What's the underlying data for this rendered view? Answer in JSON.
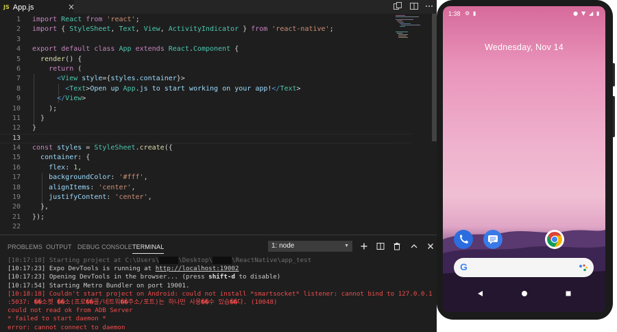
{
  "editor_tab": {
    "badge": "JS",
    "filename": "App.js",
    "close": "×"
  },
  "code": {
    "line_numbers": [
      "1",
      "2",
      "3",
      "4",
      "5",
      "6",
      "7",
      "8",
      "9",
      "10",
      "11",
      "12",
      "13",
      "14",
      "15",
      "16",
      "17",
      "18",
      "19",
      "20",
      "21",
      "22"
    ],
    "lines": [
      "import React from 'react';",
      "import { StyleSheet, Text, View, ActivityIndicator } from 'react-native';",
      "",
      "export default class App extends React.Component {",
      "  render() {",
      "    return (",
      "      <View style={styles.container}>",
      "        <Text>Open up App.js to start working on your app!</Text>",
      "      </View>",
      "    );",
      "  }",
      "}",
      "",
      "const styles = StyleSheet.create({",
      "  container: {",
      "    flex: 1,",
      "    backgroundColor: '#fff',",
      "    alignItems: 'center',",
      "    justifyContent: 'center',",
      "  },",
      "});",
      ""
    ],
    "active_line": 13
  },
  "panel": {
    "tabs": [
      "PROBLEMS",
      "OUTPUT",
      "DEBUG CONSOLE",
      "TERMINAL"
    ],
    "active_tab": "TERMINAL",
    "terminal_select": "1: node",
    "terminal_lines": [
      {
        "kind": "dim",
        "text": "[10:17:18] Starting project at C:\\Users\\"
      },
      {
        "kind": "normal",
        "pre": "[10:17:23] Expo DevTools is running at ",
        "link": "http://localhost:19002"
      },
      {
        "kind": "normal",
        "pre": "[10:17:23] Opening DevTools in the browser... (press ",
        "bold": "shift-d",
        "post": " to disable)"
      },
      {
        "kind": "normal",
        "text": "[10:17:54] Starting Metro Bundler on port 19001."
      },
      {
        "kind": "err",
        "text": "[10:18:18] Couldn't start project on Android: could not install *smartsocket* listener: cannot bind to 127.0.0.1"
      },
      {
        "kind": "err",
        "text": ":5037: ��소켓 ��소(프로��콜/네트워��주소/포트)는 하나만 사용��수 있습��다. (10048)"
      },
      {
        "kind": "err",
        "text": "could not read ok from ADB Server"
      },
      {
        "kind": "err",
        "text": "* failed to start daemon *"
      },
      {
        "kind": "err",
        "text": "error: cannot connect to daemon"
      }
    ],
    "path_parts": {
      "desktop": "\\Desktop\\",
      "rest": "\\ReactNative\\app_test"
    }
  },
  "phone": {
    "time": "1:38",
    "date": "Wednesday, Nov 14",
    "search_logo": "G"
  },
  "colors": {
    "editor_bg": "#1e1e1e",
    "error": "#f14c4c",
    "keyword": "#c586c0",
    "string": "#ce9178"
  }
}
